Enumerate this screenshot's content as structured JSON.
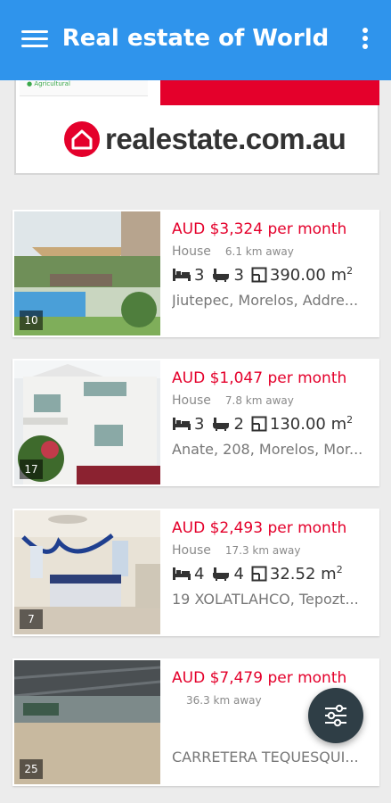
{
  "app_bar": {
    "title": "Real estate of World",
    "menu_icon": "hamburger-menu-icon",
    "more_icon": "more-vertical-icon",
    "color": "#2f94ec"
  },
  "ad": {
    "brand_text": "realestate.com.au",
    "tag_text": "● Agricultural",
    "brand_color": "#e4002b"
  },
  "listings": [
    {
      "price": "AUD $3,324 per month",
      "type": "House",
      "distance": "6.1 km away",
      "beds": "3",
      "baths": "3",
      "area": "390.00 m",
      "area_sup": "2",
      "address": "Jiutepec, Morelos, Addre...",
      "photo_count": "10"
    },
    {
      "price": "AUD $1,047 per month",
      "type": "House",
      "distance": "7.8 km away",
      "beds": "3",
      "baths": "2",
      "area": "130.00 m",
      "area_sup": "2",
      "address": "Anate, 208, Morelos, Mor...",
      "photo_count": "17"
    },
    {
      "price": "AUD $2,493 per month",
      "type": "House",
      "distance": "17.3 km away",
      "beds": "4",
      "baths": "4",
      "area": "32.52 m",
      "area_sup": "2",
      "address": "19 XOLATLAHCO, Tepozt...",
      "photo_count": "7"
    },
    {
      "price": "AUD $7,479 per month",
      "distance": "36.3 km away",
      "address": "CARRETERA TEQUESQUI...",
      "photo_count": "25"
    }
  ],
  "fab": {
    "icon": "filter-sliders-icon",
    "color": "#2f3e46"
  },
  "price_color": "#e4002b"
}
